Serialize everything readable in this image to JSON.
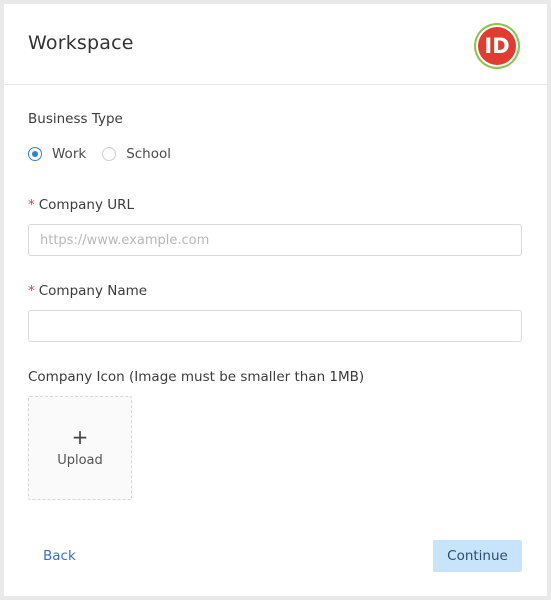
{
  "header": {
    "title": "Workspace",
    "logo_text": "ID"
  },
  "business_type": {
    "label": "Business Type",
    "options": [
      {
        "label": "Work",
        "checked": true
      },
      {
        "label": "School",
        "checked": false
      }
    ]
  },
  "company_url": {
    "required_mark": "*",
    "label": "Company URL",
    "placeholder": "https://www.example.com",
    "value": ""
  },
  "company_name": {
    "required_mark": "*",
    "label": "Company Name",
    "placeholder": "",
    "value": ""
  },
  "company_icon": {
    "label": "Company Icon (Image must be smaller than 1MB)",
    "plus": "+",
    "upload_label": "Upload"
  },
  "footer": {
    "back_label": "Back",
    "continue_label": "Continue"
  },
  "colors": {
    "accent": "#2f7fd6",
    "required": "#e04040",
    "link": "#3b6fc2",
    "continue_bg": "#c8e4fb",
    "logo_red": "#e03c31",
    "logo_ring": "#8bc34a"
  }
}
